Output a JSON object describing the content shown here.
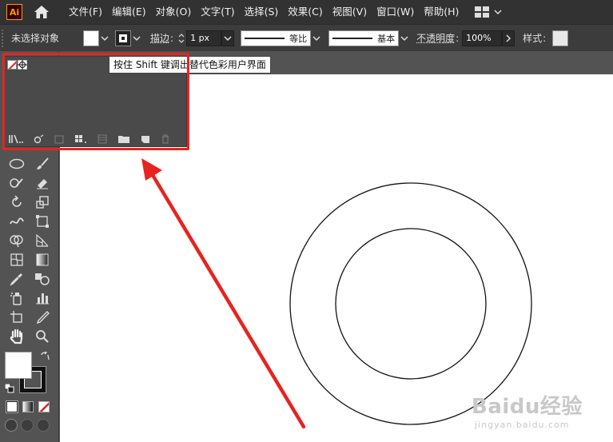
{
  "app": {
    "logo": "Ai"
  },
  "menu": {
    "items": [
      "文件(F)",
      "编辑(E)",
      "对象(O)",
      "文字(T)",
      "选择(S)",
      "效果(C)",
      "视图(V)",
      "窗口(W)",
      "帮助(H)"
    ]
  },
  "control_bar": {
    "selection_status": "未选择对象",
    "stroke_label": "描边",
    "stroke_weight": "1 px",
    "stroke_profile": "等比",
    "brush": "基本",
    "opacity_label": "不透明度",
    "opacity_value": "100%",
    "style_label": "样式"
  },
  "popup": {
    "tooltip": "按住 Shift 键调出替代色彩用户界面"
  },
  "colors": {
    "highlight": "#e8231f",
    "menubar_bg": "#323232",
    "panel_bg": "#535353",
    "canvas_bg": "#ffffff"
  },
  "watermark": {
    "logo": "Baidu经验",
    "url": "jingyan.baidu.com"
  },
  "icons": [
    "home-icon",
    "workspace-icon",
    "library-icon",
    "swatch-options-icon",
    "new-group-icon",
    "folder-icon",
    "new-swatch-icon",
    "delete-icon",
    "ellipse-icon",
    "brush-icon",
    "eraser-icon",
    "rotate-icon",
    "scale-icon",
    "warp-icon",
    "free-transform-icon",
    "shape-builder-icon",
    "perspective-icon",
    "mesh-icon",
    "gradient-icon",
    "eyedropper-icon",
    "blend-icon",
    "symbol-sprayer-icon",
    "graph-icon",
    "artboard-icon",
    "slice-icon",
    "hand-icon",
    "zoom-icon"
  ]
}
